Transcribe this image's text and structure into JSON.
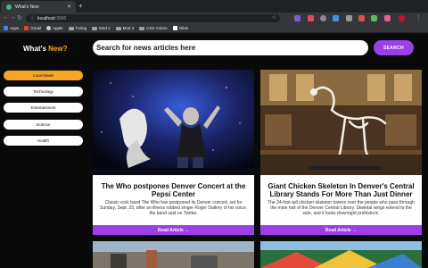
{
  "browser": {
    "tab_title": "What's New",
    "url_host": "localhost",
    "url_port": ":3000",
    "bookmarks": [
      "Apps",
      "Gmail",
      "Apple",
      "Turing",
      "Mod 2",
      "Mod 3",
      "CSS Colors",
      "Glide"
    ]
  },
  "header": {
    "brand_prefix": "What's ",
    "brand_accent": "New?",
    "search_placeholder": "Search for news articles here",
    "search_button": "SEARCH"
  },
  "categories": [
    "Local News",
    "Technology",
    "Entertainment",
    "Science",
    "Health"
  ],
  "active_category": "Local News",
  "articles": [
    {
      "title": "The Who postpones Denver Concert at the Pepsi Center",
      "description": "Classic-rock band The Who has postponed its Denver concert, set for Sunday, Sept. 29, after an illness robbed singer Roger Daltrey of his voice, the band said on Twitter.",
      "link": "Read Article →"
    },
    {
      "title": "Giant Chicken Skeleton In Denver's Central Library Stands For More Than Just Dinner",
      "description": "The 24-foot-tall chicken skeleton towers over the people who pass through the main hall of the Denver Central Library. Skeletal wings extend to the side, and it looks downright prehistoric.",
      "link": "Read Article →"
    }
  ],
  "colors": {
    "accent_orange": "#f5a623",
    "accent_purple": "#9b40e8"
  }
}
